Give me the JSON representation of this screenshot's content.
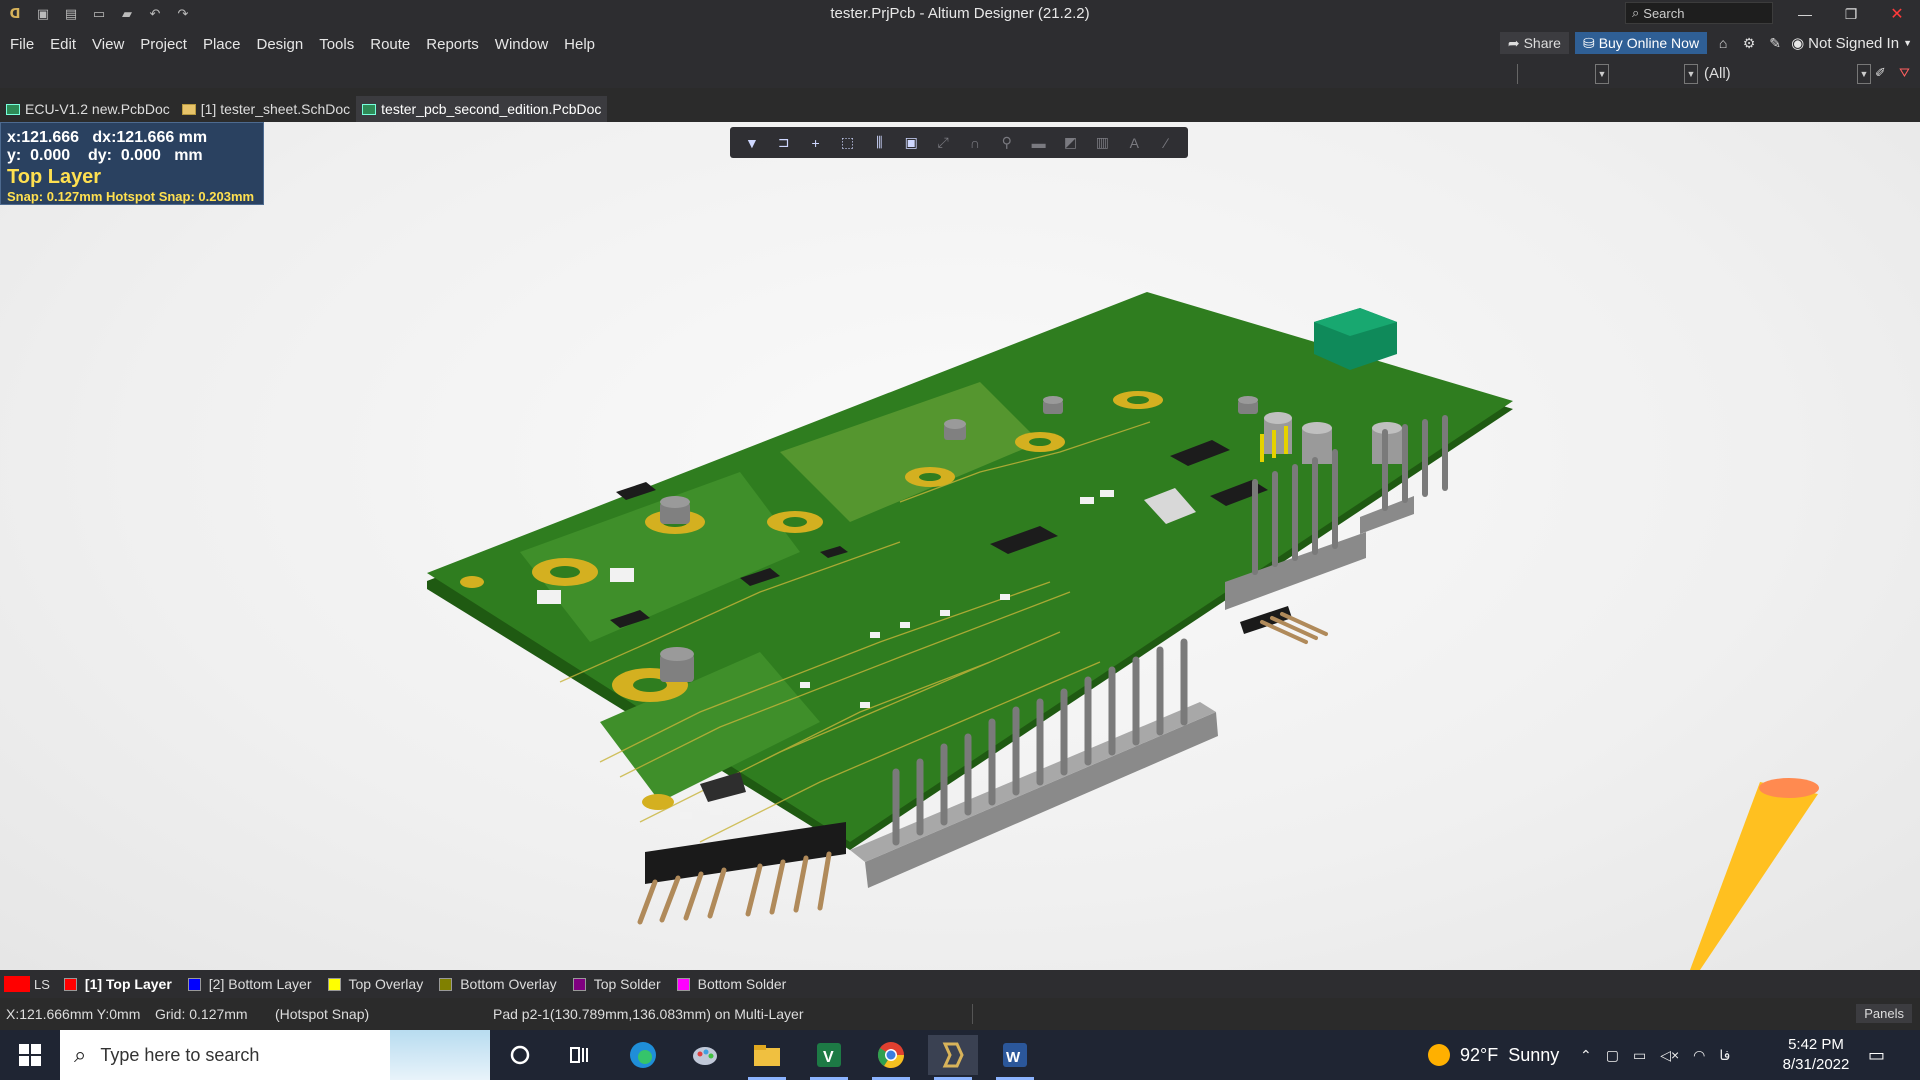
{
  "window": {
    "title": "tester.PrjPcb - Altium Designer (21.2.2)",
    "search_placeholder": "Search"
  },
  "menu": {
    "items": [
      "File",
      "Edit",
      "View",
      "Project",
      "Place",
      "Design",
      "Tools",
      "Route",
      "Reports",
      "Window",
      "Help"
    ],
    "share_label": "Share",
    "buy_label": "Buy Online Now",
    "signin_label": "Not Signed In"
  },
  "filter": {
    "selected": "(All)"
  },
  "doc_tabs": [
    {
      "label": "ECU-V1.2 new.PcbDoc",
      "icon": "pcb-doc-icon"
    },
    {
      "label": "[1] tester_sheet.SchDoc",
      "icon": "sch-doc-icon"
    },
    {
      "label": "tester_pcb_second_edition.PcbDoc",
      "icon": "pcb-doc-icon"
    }
  ],
  "hud": {
    "line1": "x:121.666   dx:121.666 mm",
    "line2": "y:  0.000    dy:  0.000   mm",
    "layer": "Top Layer",
    "snap": "Snap: 0.127mm Hotspot Snap: 0.203mm"
  },
  "toolbar_icons": [
    "filter-icon",
    "route-icon",
    "cross-icon",
    "select-rect-icon",
    "align-icon",
    "component-icon",
    "net-icon",
    "polygon-icon",
    "pad-icon",
    "fill-icon",
    "dimension-icon",
    "graph-icon",
    "text-icon",
    "line-icon"
  ],
  "layers": {
    "ls_label": "LS",
    "tabs": [
      {
        "label": "[1] Top Layer",
        "color": "#ff0000"
      },
      {
        "label": "[2] Bottom Layer",
        "color": "#0000ff"
      },
      {
        "label": "Top Overlay",
        "color": "#ffff00"
      },
      {
        "label": "Bottom Overlay",
        "color": "#808000"
      },
      {
        "label": "Top Solder",
        "color": "#800080"
      },
      {
        "label": "Bottom Solder",
        "color": "#ff00ff"
      }
    ]
  },
  "status": {
    "coords": "X:121.666mm Y:0mm",
    "grid": "Grid: 0.127mm",
    "snap_mode": "(Hotspot Snap)",
    "pad_info": "Pad p2-1(130.789mm,136.083mm) on Multi-Layer",
    "panels_label": "Panels"
  },
  "taskbar": {
    "search_placeholder": "Type here to search",
    "weather_temp": "92°F",
    "weather_desc": "Sunny",
    "lang": "فا",
    "time": "5:42 PM",
    "date": "8/31/2022"
  },
  "colors": {
    "board_green": "#2f7d1f",
    "pad_gold": "#d4b020",
    "hud_bg": "#2a4160",
    "hud_yellow": "#ffe050"
  }
}
